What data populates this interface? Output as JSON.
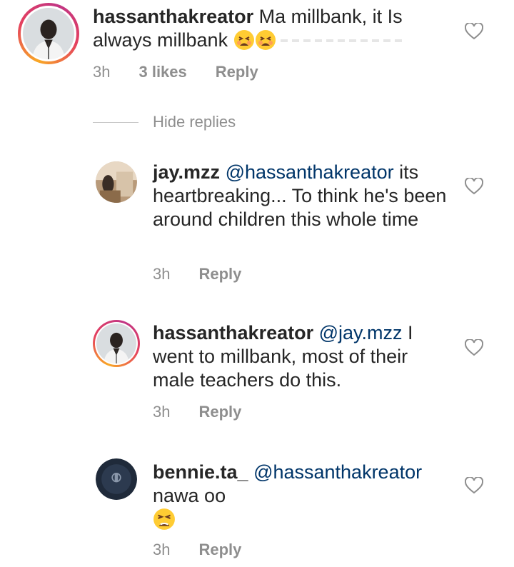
{
  "comments": [
    {
      "username": "hassanthakreator",
      "mention": "",
      "text": " Ma millbank, it Is always millbank",
      "time": "3h",
      "likes": "3 likes",
      "reply": "Reply"
    },
    {
      "username": "jay.mzz",
      "mention": "@hassanthakreator",
      "text": " its heartbreaking... To think he's been around children this whole time",
      "time": "3h",
      "reply": "Reply"
    },
    {
      "username": "hassanthakreator",
      "mention": "@jay.mzz",
      "text": " I went to millbank, most of their male teachers do this.",
      "time": "3h",
      "reply": "Reply"
    },
    {
      "username": "bennie.ta_",
      "mention": "@hassanthakreator",
      "text": "nawa oo",
      "time": "3h",
      "reply": "Reply"
    }
  ],
  "hide_replies": "Hide replies",
  "icons": {
    "like": "heart-outline-icon",
    "emoji_tired": "tired-face-emoji",
    "emoji_persevere": "persevering-face-emoji"
  },
  "colors": {
    "text": "#262626",
    "muted": "#8e8e8e",
    "mention": "#003569",
    "ring_start": "#f9a825",
    "ring_end": "#c13584"
  }
}
